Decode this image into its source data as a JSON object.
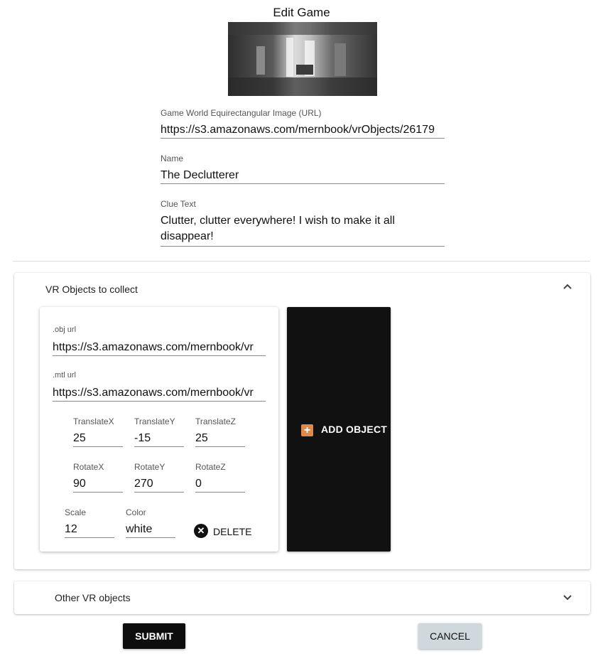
{
  "page": {
    "title": "Edit Game"
  },
  "game": {
    "image_url": {
      "label": "Game World Equirectangular Image (URL)",
      "value": "https://s3.amazonaws.com/mernbook/vrObjects/26179"
    },
    "name": {
      "label": "Name",
      "value": "The Declutterer"
    },
    "clue": {
      "label": "Clue Text",
      "line1": "Clutter, clutter everywhere! I wish to make it all",
      "line2": "disappear!"
    }
  },
  "vr_collect": {
    "title": "VR Objects to collect",
    "object": {
      "obj_url": {
        "label": ".obj url",
        "value": "https://s3.amazonaws.com/mernbook/vr"
      },
      "mtl_url": {
        "label": ".mtl url",
        "value": "https://s3.amazonaws.com/mernbook/vr"
      },
      "translate_x": {
        "label": "TranslateX",
        "value": "25"
      },
      "translate_y": {
        "label": "TranslateY",
        "value": "-15"
      },
      "translate_z": {
        "label": "TranslateZ",
        "value": "25"
      },
      "rotate_x": {
        "label": "RotateX",
        "value": "90"
      },
      "rotate_y": {
        "label": "RotateY",
        "value": "270"
      },
      "rotate_z": {
        "label": "RotateZ",
        "value": "0"
      },
      "scale": {
        "label": "Scale",
        "value": "12"
      },
      "color": {
        "label": "Color",
        "value": "white"
      },
      "delete_label": "DELETE"
    },
    "add_object_label": "ADD OBJECT",
    "add_icon": "plus-icon"
  },
  "other_vr": {
    "title": "Other VR objects"
  },
  "buttons": {
    "submit": "SUBMIT",
    "cancel": "CANCEL"
  },
  "colors": {
    "add_object_bg": "#111111",
    "add_icon": "#d98a4e",
    "cancel_bg": "#cfd8dc",
    "submit_bg": "#0d0d0d"
  }
}
